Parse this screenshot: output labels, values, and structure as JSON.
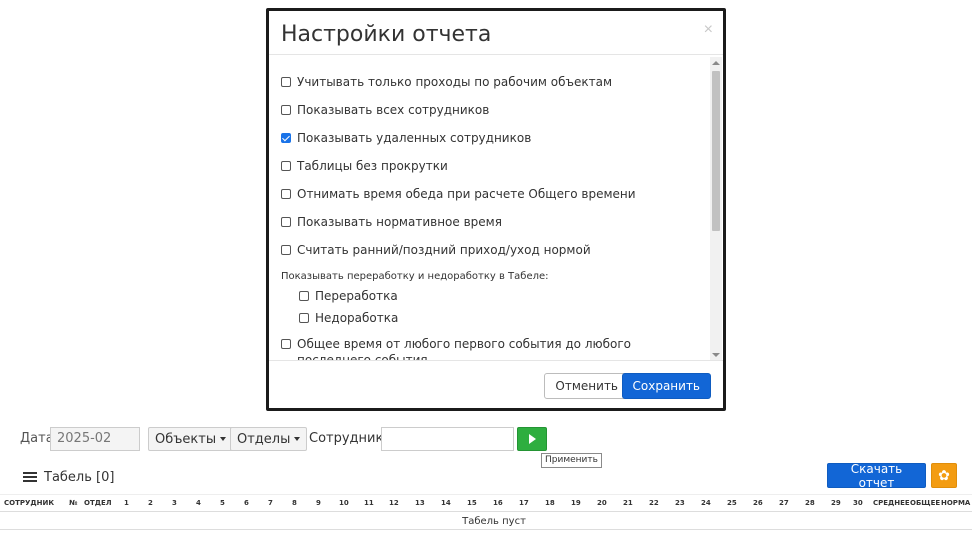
{
  "modal": {
    "title": "Настройки отчета",
    "close_glyph": "×",
    "options": [
      {
        "label": "Учитывать только проходы по рабочим объектам",
        "checked": false
      },
      {
        "label": "Показывать всех сотрудников",
        "checked": false
      },
      {
        "label": "Показывать удаленных сотрудников",
        "checked": true
      },
      {
        "label": "Таблицы без прокрутки",
        "checked": false
      },
      {
        "label": "Отнимать время обеда при расчете Общего времени",
        "checked": false
      },
      {
        "label": "Показывать нормативное время",
        "checked": false
      },
      {
        "label": "Считать ранний/поздний приход/уход нормой",
        "checked": false
      }
    ],
    "overtime_group": {
      "title": "Показывать переработку и недоработку в Табеле:",
      "options": [
        {
          "label": "Переработка",
          "checked": false
        },
        {
          "label": "Недоработка",
          "checked": false
        }
      ]
    },
    "total_time_option": {
      "label": "Общее время от любого первого события до любого последнего события",
      "checked": false
    },
    "cancel_label": "Отменить",
    "save_label": "Сохранить"
  },
  "toolbar": {
    "date_label": "Дата",
    "date_value": "2025-02",
    "objects_label": "Объекты",
    "departments_label": "Отделы",
    "employees_label": "Сотрудники",
    "employees_value": "",
    "apply_tooltip": "Применить"
  },
  "panel": {
    "title": "Табель [0]",
    "download_label": "Скачать отчет",
    "settings_icon": "gear-icon"
  },
  "table": {
    "headers": [
      "СОТРУДНИК",
      "№",
      "ОТДЕЛ",
      "1",
      "2",
      "3",
      "4",
      "5",
      "6",
      "7",
      "8",
      "9",
      "10",
      "11",
      "12",
      "13",
      "14",
      "15",
      "16",
      "17",
      "18",
      "19",
      "20",
      "21",
      "22",
      "23",
      "24",
      "25",
      "26",
      "27",
      "28",
      "29",
      "30",
      "СРЕДНЕЕ",
      "ОБЩЕЕ",
      "НОРМА"
    ],
    "empty_text": "Табель пуст"
  },
  "colors": {
    "primary": "#1266d6",
    "success": "#2eae3f",
    "warning": "#f39c12"
  }
}
